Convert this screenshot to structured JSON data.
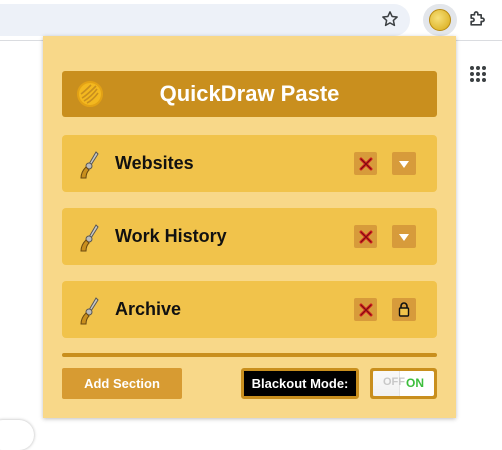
{
  "browser": {
    "icons": {
      "bookmark": "star-icon",
      "extension": "quickdraw-extension-icon",
      "extensions_menu": "puzzle-icon",
      "apps": "apps-grid-icon"
    }
  },
  "popup": {
    "title": "QuickDraw Paste",
    "logo_icon": "gold-coin-icon",
    "sections": [
      {
        "label": "Websites",
        "icon": "revolver-icon",
        "delete_icon": "red-x-icon",
        "toggle_icon": "chevron-down-icon"
      },
      {
        "label": "Work History",
        "icon": "revolver-icon",
        "delete_icon": "red-x-icon",
        "toggle_icon": "chevron-down-icon"
      },
      {
        "label": "Archive",
        "icon": "revolver-icon",
        "delete_icon": "red-x-icon",
        "toggle_icon": "lock-icon"
      }
    ],
    "add_section_label": "Add Section",
    "blackout_label": "Blackout Mode:",
    "switch": {
      "off_label": "OFF",
      "on_label": "ON"
    }
  },
  "colors": {
    "popup_bg": "#f8d889",
    "header_bg": "#c98f1e",
    "section_bg": "#f1c34b",
    "button_bg": "#d79b3b",
    "delete_x": "#d32020",
    "switch_on": "#3dbe3d"
  }
}
